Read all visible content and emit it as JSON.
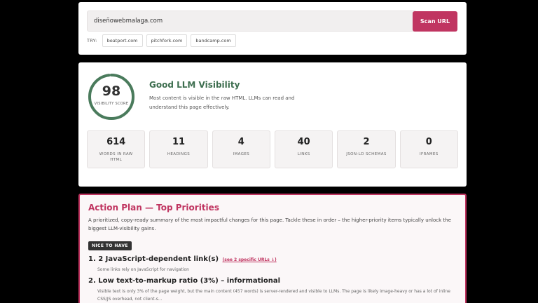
{
  "scan": {
    "url_value": "diseñowebmalaga.com",
    "button_label": "Scan URL",
    "try_label": "TRY:",
    "examples": [
      "beatport.com",
      "pitchfork.com",
      "bandcamp.com"
    ]
  },
  "score": {
    "value": "98",
    "percent": 98,
    "sublabel": "VISIBILITY SCORE",
    "title": "Good LLM Visibility",
    "description": "Most content is visible in the raw HTML. LLMs can read and understand this page effectively.",
    "ring_color": "#4a7b5c"
  },
  "stats": [
    {
      "value": "614",
      "label": "WORDS IN RAW HTML"
    },
    {
      "value": "11",
      "label": "HEADINGS"
    },
    {
      "value": "4",
      "label": "IMAGES"
    },
    {
      "value": "40",
      "label": "LINKS"
    },
    {
      "value": "2",
      "label": "JSON-LD SCHEMAS"
    },
    {
      "value": "0",
      "label": "IFRAMES"
    }
  ],
  "action_plan": {
    "title": "Action Plan — Top Priorities",
    "intro": "A prioritized, copy-ready summary of the most impactful changes for this page. Tackle these in order – the higher-priority items typically unlock the biggest LLM-visibility gains.",
    "badge": "NICE TO HAVE",
    "items": [
      {
        "title": "1. 2 JavaScript-dependent link(s)",
        "link": "(see 2 specific URLs ↓)",
        "desc": "Some links rely on JavaScript for navigation"
      },
      {
        "title": "2. Low text-to-markup ratio (3%) – informational",
        "desc": "Visible text is only 3% of the page weight, but the main content (457 words) is server-rendered and visible to LLMs. The page is likely image-heavy or has a lot of inline CSS/JS overhead, not client-s..."
      }
    ]
  },
  "colors": {
    "accent": "#c03561",
    "good": "#3d6e4f"
  }
}
